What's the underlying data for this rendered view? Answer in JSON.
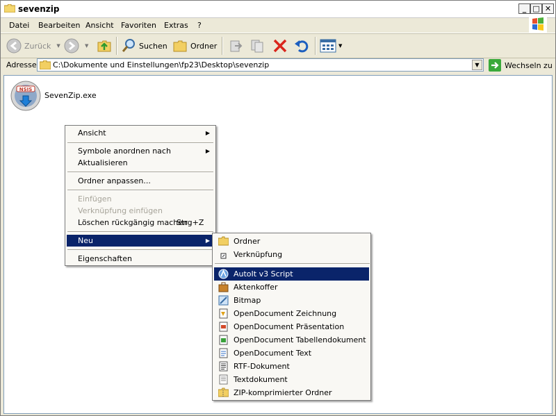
{
  "window": {
    "title": "sevenzip"
  },
  "menubar": [
    "Datei",
    "Bearbeiten",
    "Ansicht",
    "Favoriten",
    "Extras",
    "?"
  ],
  "toolbar": {
    "back_label": "Zurück",
    "search_label": "Suchen",
    "folders_label": "Ordner"
  },
  "address": {
    "label": "Adresse",
    "path": "C:\\Dokumente und Einstellungen\\fp23\\Desktop\\sevenzip",
    "go_label": "Wechseln zu"
  },
  "files": [
    {
      "name": "SevenZip.exe",
      "icon": "nsis-installer-icon"
    }
  ],
  "context_menu": {
    "items": [
      {
        "label": "Ansicht",
        "submenu": true
      },
      {
        "label": "Symbole anordnen nach",
        "submenu": true
      },
      {
        "label": "Aktualisieren"
      },
      {
        "label": "Ordner anpassen..."
      },
      {
        "label": "Einfügen",
        "disabled": true
      },
      {
        "label": "Verknüpfung einfügen",
        "disabled": true
      },
      {
        "label": "Löschen rückgängig machen",
        "shortcut": "Strg+Z"
      },
      {
        "label": "Neu",
        "submenu": true,
        "selected": true
      },
      {
        "label": "Eigenschaften"
      }
    ]
  },
  "new_submenu": {
    "items": [
      {
        "label": "Ordner",
        "icon": "folder-icon"
      },
      {
        "label": "Verknüpfung",
        "icon": "shortcut-icon"
      },
      {
        "label": "AutoIt v3 Script",
        "icon": "autoit-icon",
        "selected": true
      },
      {
        "label": "Aktenkoffer",
        "icon": "briefcase-icon"
      },
      {
        "label": "Bitmap",
        "icon": "bitmap-icon"
      },
      {
        "label": "OpenDocument Zeichnung",
        "icon": "odg-icon"
      },
      {
        "label": "OpenDocument Präsentation",
        "icon": "odp-icon"
      },
      {
        "label": "OpenDocument Tabellendokument",
        "icon": "ods-icon"
      },
      {
        "label": "OpenDocument Text",
        "icon": "odt-icon"
      },
      {
        "label": "RTF-Dokument",
        "icon": "rtf-icon"
      },
      {
        "label": "Textdokument",
        "icon": "txt-icon"
      },
      {
        "label": "ZIP-komprimierter Ordner",
        "icon": "zip-icon"
      }
    ]
  },
  "colors": {
    "selection": "#0a246a",
    "chrome": "#ece9d8",
    "disabled": "#a7a49a"
  }
}
